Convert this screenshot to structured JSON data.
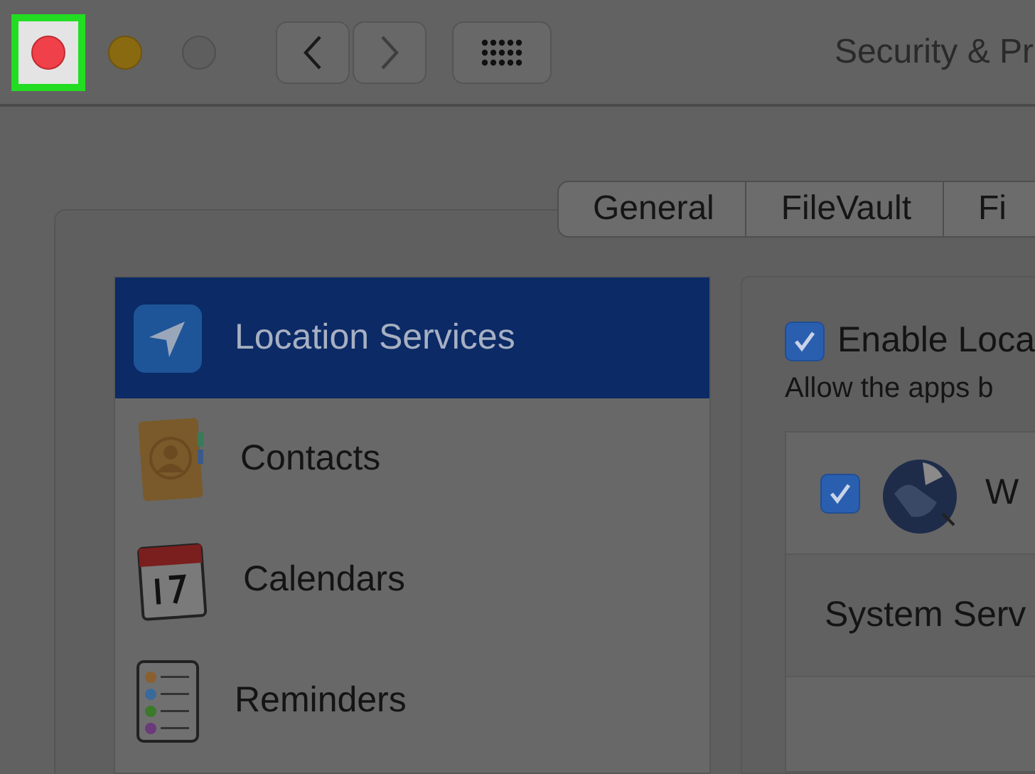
{
  "window": {
    "title": "Security & Pr",
    "controls": [
      {
        "kind": "close",
        "highlighted": true
      },
      {
        "kind": "minimize",
        "highlighted": false
      },
      {
        "kind": "zoom",
        "highlighted": false
      }
    ]
  },
  "toolbar": {
    "buttons": [
      {
        "kind": "back"
      },
      {
        "kind": "forward"
      },
      {
        "kind": "grid"
      }
    ]
  },
  "tabs": [
    {
      "label": "General",
      "selected": false
    },
    {
      "label": "FileVault",
      "selected": false
    },
    {
      "label": "Fi",
      "selected": false
    }
  ],
  "sidebar": {
    "items": [
      {
        "label": "Location Services",
        "kind": "location",
        "selected": true
      },
      {
        "label": "Contacts",
        "kind": "contacts",
        "selected": false
      },
      {
        "label": "Calendars",
        "kind": "calendar",
        "selected": false
      },
      {
        "label": "Reminders",
        "kind": "reminders",
        "selected": false
      }
    ]
  },
  "location": {
    "enable": {
      "label": "Enable Loca",
      "checked": true
    },
    "description": "Allow the apps b",
    "apps": [
      {
        "kind": "app",
        "name": "W",
        "checked": true
      },
      {
        "kind": "group",
        "name": "System Serv"
      }
    ]
  }
}
